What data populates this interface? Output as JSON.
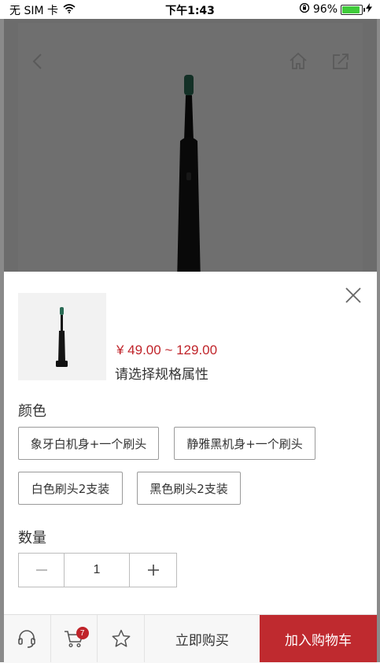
{
  "status_bar": {
    "carrier": "无 SIM 卡",
    "time": "下午1:43",
    "battery": "96%"
  },
  "sheet": {
    "price": "¥ 49.00 ~ 129.00",
    "hint": "请选择规格属性",
    "color_label": "颜色",
    "color_options": [
      "象牙白机身+一个刷头",
      "静雅黑机身+一个刷头",
      "白色刷头2支装",
      "黑色刷头2支装"
    ],
    "quantity_label": "数量",
    "quantity": "1"
  },
  "bottom_bar": {
    "cart_count": "7",
    "buy_now": "立即购买",
    "add_to_cart": "加入购物车"
  },
  "colors": {
    "accent": "#c0242a",
    "add_to_cart_bg": "#bf2a2f",
    "battery_green": "#3fcb3a"
  },
  "icons": [
    "wifi-icon",
    "back-icon",
    "home-icon",
    "share-icon",
    "close-icon",
    "headset-icon",
    "cart-icon",
    "star-icon"
  ]
}
